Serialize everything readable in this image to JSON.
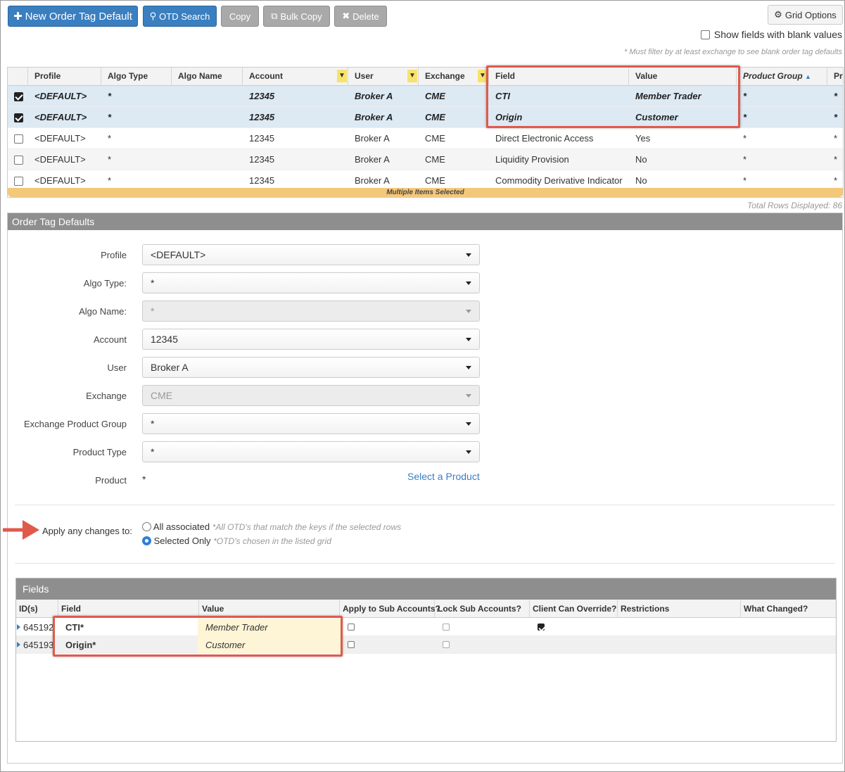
{
  "toolbar": {
    "new_label": "New Order Tag Default",
    "search_label": "OTD Search",
    "copy_label": "Copy",
    "bulk_copy_label": "Bulk Copy",
    "delete_label": "Delete",
    "grid_options_label": "Grid Options",
    "blank_values_label": "Show fields with blank values",
    "note": "* Must filter by at least exchange to see blank order tag defaults"
  },
  "grid": {
    "columns": [
      "Profile",
      "Algo Type",
      "Algo Name",
      "Account",
      "User",
      "Exchange",
      "Field",
      "Value",
      "Product Group",
      "Pro"
    ],
    "rows": [
      {
        "profile": "<DEFAULT>",
        "algo_type": "*",
        "account": "12345",
        "user": "Broker A",
        "exchange": "CME",
        "field": "CTI",
        "value": "Member Trader",
        "product_group": "*",
        "pro": "*"
      },
      {
        "profile": "<DEFAULT>",
        "algo_type": "*",
        "account": "12345",
        "user": "Broker A",
        "exchange": "CME",
        "field": "Origin",
        "value": "Customer",
        "product_group": "*",
        "pro": "*"
      },
      {
        "profile": "<DEFAULT>",
        "algo_type": "*",
        "account": "12345",
        "user": "Broker A",
        "exchange": "CME",
        "field": "Direct Electronic Access",
        "value": "Yes",
        "product_group": "*",
        "pro": "*"
      },
      {
        "profile": "<DEFAULT>",
        "algo_type": "*",
        "account": "12345",
        "user": "Broker A",
        "exchange": "CME",
        "field": "Liquidity Provision",
        "value": "No",
        "product_group": "*",
        "pro": "*"
      },
      {
        "profile": "<DEFAULT>",
        "algo_type": "*",
        "account": "12345",
        "user": "Broker A",
        "exchange": "CME",
        "field": "Commodity Derivative Indicator",
        "value": "No",
        "product_group": "*",
        "pro": "*"
      }
    ],
    "selection_banner": "Multiple Items Selected",
    "total_rows": "Total Rows Displayed: 86"
  },
  "form": {
    "title": "Order Tag Defaults",
    "profile_label": "Profile",
    "profile_value": "<DEFAULT>",
    "algo_type_label": "Algo Type:",
    "algo_type_value": "*",
    "algo_name_label": "Algo Name:",
    "algo_name_value": "*",
    "account_label": "Account",
    "account_value": "12345",
    "user_label": "User",
    "user_value": "Broker A",
    "exchange_label": "Exchange",
    "exchange_value": "CME",
    "epg_label": "Exchange Product Group",
    "epg_value": "*",
    "product_type_label": "Product Type",
    "product_type_value": "*",
    "product_label": "Product",
    "product_value": "*",
    "select_product_link": "Select a Product",
    "apply_label": "Apply any changes to:",
    "opt_all_label": "All associated",
    "opt_all_hint": "*All OTD's that match the keys if the selected rows",
    "opt_sel_label": "Selected Only",
    "opt_sel_hint": "*OTD's chosen in the listed grid"
  },
  "fields": {
    "title": "Fields",
    "columns": [
      "ID(s)",
      "Field",
      "Value",
      "Apply to Sub Accounts?",
      "Lock Sub Accounts?",
      "Client Can Override?",
      "Restrictions",
      "What Changed?"
    ],
    "rows": [
      {
        "id": "645192",
        "field": "CTI*",
        "value": "Member Trader"
      },
      {
        "id": "645193",
        "field": "Origin*",
        "value": "Customer"
      }
    ]
  },
  "colors": {
    "primary": "#3a7fc0",
    "highlight": "#e05a4c",
    "banner": "#f4c87a"
  }
}
